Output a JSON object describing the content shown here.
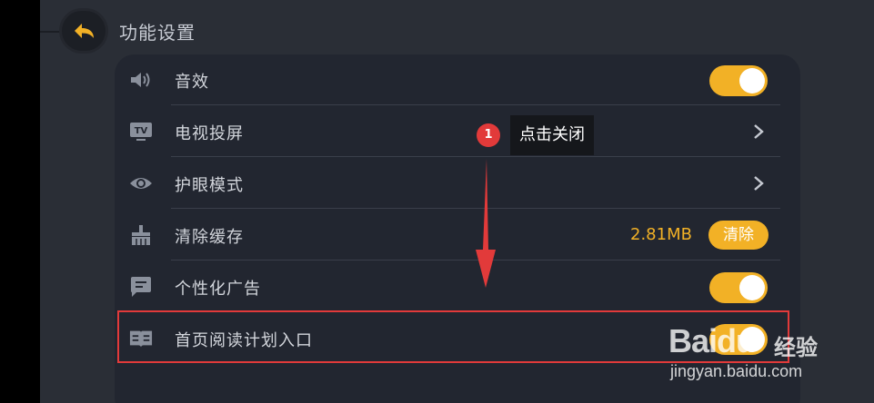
{
  "header": {
    "title": "功能设置"
  },
  "settings": {
    "rows": [
      {
        "label": "音效",
        "icon": "speaker-icon",
        "control": "toggle",
        "on": true
      },
      {
        "label": "电视投屏",
        "icon": "tv-icon",
        "control": "chevron"
      },
      {
        "label": "护眼模式",
        "icon": "eye-icon",
        "control": "chevron"
      },
      {
        "label": "清除缓存",
        "icon": "broom-icon",
        "control": "button",
        "value": "2.81MB",
        "button_label": "清除"
      },
      {
        "label": "个性化广告",
        "icon": "chat-icon",
        "control": "toggle",
        "on": true
      },
      {
        "label": "首页阅读计划入口",
        "icon": "book-icon",
        "control": "toggle",
        "on": true
      }
    ]
  },
  "annotation": {
    "step_number": "1",
    "tip": "点击关闭"
  },
  "watermark": {
    "brand": "Baidu",
    "brand_suffix": "经验",
    "url": "jingyan.baidu.com"
  },
  "colors": {
    "accent": "#f2b126",
    "background": "#2a2e36",
    "panel": "#222630",
    "annotation_red": "#e23a3a"
  }
}
